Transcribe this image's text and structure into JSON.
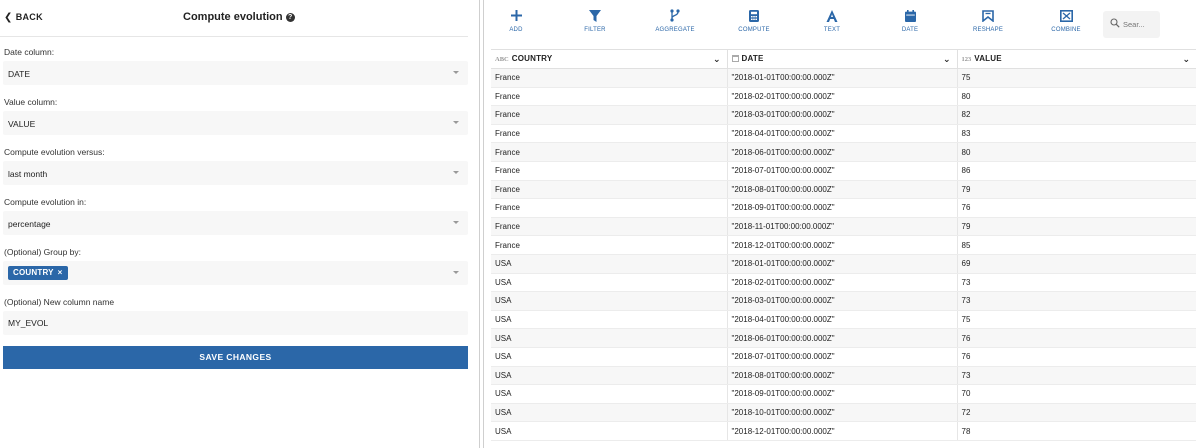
{
  "left_panel": {
    "back_label": "BACK",
    "title": "Compute evolution",
    "fields": {
      "date_column": {
        "label": "Date column:",
        "value": "DATE"
      },
      "value_column": {
        "label": "Value column:",
        "value": "VALUE"
      },
      "versus": {
        "label": "Compute evolution versus:",
        "value": "last month"
      },
      "in": {
        "label": "Compute evolution in:",
        "value": "percentage"
      },
      "group_by": {
        "label": "(Optional) Group by:",
        "tag": "COUNTRY",
        "tag_remove": "×"
      },
      "new_column": {
        "label": "(Optional) New column name",
        "value": "MY_EVOL"
      }
    },
    "save_label": "SAVE CHANGES"
  },
  "toolbar": {
    "tools": [
      {
        "label": "ADD",
        "icon": "plus-icon"
      },
      {
        "label": "FILTER",
        "icon": "filter-icon"
      },
      {
        "label": "AGGREGATE",
        "icon": "aggregate-icon"
      },
      {
        "label": "COMPUTE",
        "icon": "calculator-icon"
      },
      {
        "label": "TEXT",
        "icon": "text-icon"
      },
      {
        "label": "DATE",
        "icon": "calendar-icon"
      },
      {
        "label": "RESHAPE",
        "icon": "reshape-icon"
      },
      {
        "label": "COMBINE",
        "icon": "combine-icon"
      }
    ],
    "search_placeholder": "Sear..."
  },
  "table": {
    "columns": [
      {
        "type": "ABC",
        "name": "COUNTRY"
      },
      {
        "type": "date",
        "name": "DATE"
      },
      {
        "type": "123",
        "name": "VALUE"
      }
    ],
    "rows": [
      [
        "France",
        "\"2018-01-01T00:00:00.000Z\"",
        "75"
      ],
      [
        "France",
        "\"2018-02-01T00:00:00.000Z\"",
        "80"
      ],
      [
        "France",
        "\"2018-03-01T00:00:00.000Z\"",
        "82"
      ],
      [
        "France",
        "\"2018-04-01T00:00:00.000Z\"",
        "83"
      ],
      [
        "France",
        "\"2018-06-01T00:00:00.000Z\"",
        "80"
      ],
      [
        "France",
        "\"2018-07-01T00:00:00.000Z\"",
        "86"
      ],
      [
        "France",
        "\"2018-08-01T00:00:00.000Z\"",
        "79"
      ],
      [
        "France",
        "\"2018-09-01T00:00:00.000Z\"",
        "76"
      ],
      [
        "France",
        "\"2018-11-01T00:00:00.000Z\"",
        "79"
      ],
      [
        "France",
        "\"2018-12-01T00:00:00.000Z\"",
        "85"
      ],
      [
        "USA",
        "\"2018-01-01T00:00:00.000Z\"",
        "69"
      ],
      [
        "USA",
        "\"2018-02-01T00:00:00.000Z\"",
        "73"
      ],
      [
        "USA",
        "\"2018-03-01T00:00:00.000Z\"",
        "73"
      ],
      [
        "USA",
        "\"2018-04-01T00:00:00.000Z\"",
        "75"
      ],
      [
        "USA",
        "\"2018-06-01T00:00:00.000Z\"",
        "76"
      ],
      [
        "USA",
        "\"2018-07-01T00:00:00.000Z\"",
        "76"
      ],
      [
        "USA",
        "\"2018-08-01T00:00:00.000Z\"",
        "73"
      ],
      [
        "USA",
        "\"2018-09-01T00:00:00.000Z\"",
        "70"
      ],
      [
        "USA",
        "\"2018-10-01T00:00:00.000Z\"",
        "72"
      ],
      [
        "USA",
        "\"2018-12-01T00:00:00.000Z\"",
        "78"
      ]
    ]
  },
  "colors": {
    "accent": "#2b67a8",
    "stripe": "#f7f7f7",
    "field_bg": "#f7f7f7"
  }
}
